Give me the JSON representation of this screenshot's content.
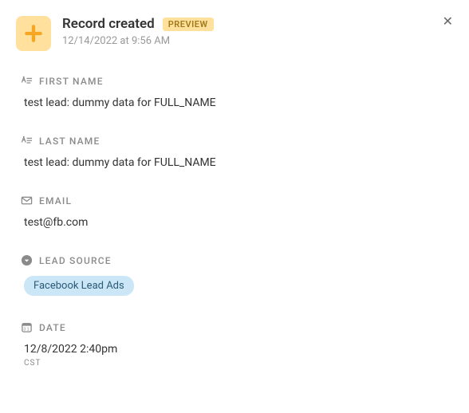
{
  "header": {
    "title": "Record created",
    "badge": "PREVIEW",
    "timestamp": "12/14/2022 at 9:56 AM"
  },
  "fields": {
    "first_name": {
      "label": "FIRST NAME",
      "value": "test lead: dummy data for FULL_NAME"
    },
    "last_name": {
      "label": "LAST NAME",
      "value": "test lead: dummy data for FULL_NAME"
    },
    "email": {
      "label": "EMAIL",
      "value": "test@fb.com"
    },
    "lead_source": {
      "label": "LEAD SOURCE",
      "value": "Facebook Lead Ads"
    },
    "date": {
      "label": "DATE",
      "value": "12/8/2022 2:40pm",
      "tz": "CST"
    }
  }
}
